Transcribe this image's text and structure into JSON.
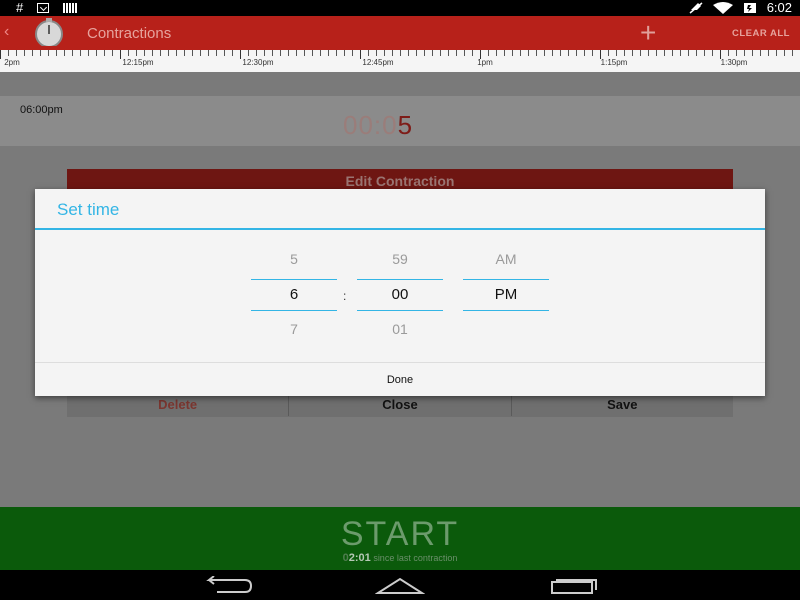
{
  "status_bar": {
    "hash": "#",
    "time": "6:02"
  },
  "app_bar": {
    "title": "Contractions",
    "add_label": "+",
    "clear_all_label": "CLEAR ALL"
  },
  "timeline": {
    "labels": [
      "2pm",
      "12:15pm",
      "12:30pm",
      "12:45pm",
      "1pm",
      "1:15pm",
      "1:30pm"
    ]
  },
  "entry": {
    "time": "06:00pm",
    "duration_prefix": "00:0",
    "duration_highlight": "5"
  },
  "edit_card": {
    "title": "Edit Contraction",
    "delete_label": "Delete",
    "close_label": "Close",
    "save_label": "Save"
  },
  "dialog": {
    "title": "Set time",
    "hour": {
      "prev": "5",
      "selected": "6",
      "next": "7"
    },
    "separator": ":",
    "minute": {
      "prev": "59",
      "selected": "00",
      "next": "01"
    },
    "ampm": {
      "prev": "AM",
      "selected": "PM",
      "next": ""
    },
    "done_label": "Done"
  },
  "start_bar": {
    "label": "START",
    "elapsed_prefix": "0",
    "elapsed": "2:01",
    "since_text": "since last contraction"
  },
  "colors": {
    "app_bar": "#b7211a",
    "accent": "#33b5e5",
    "start_bar": "#0b5a0b"
  }
}
